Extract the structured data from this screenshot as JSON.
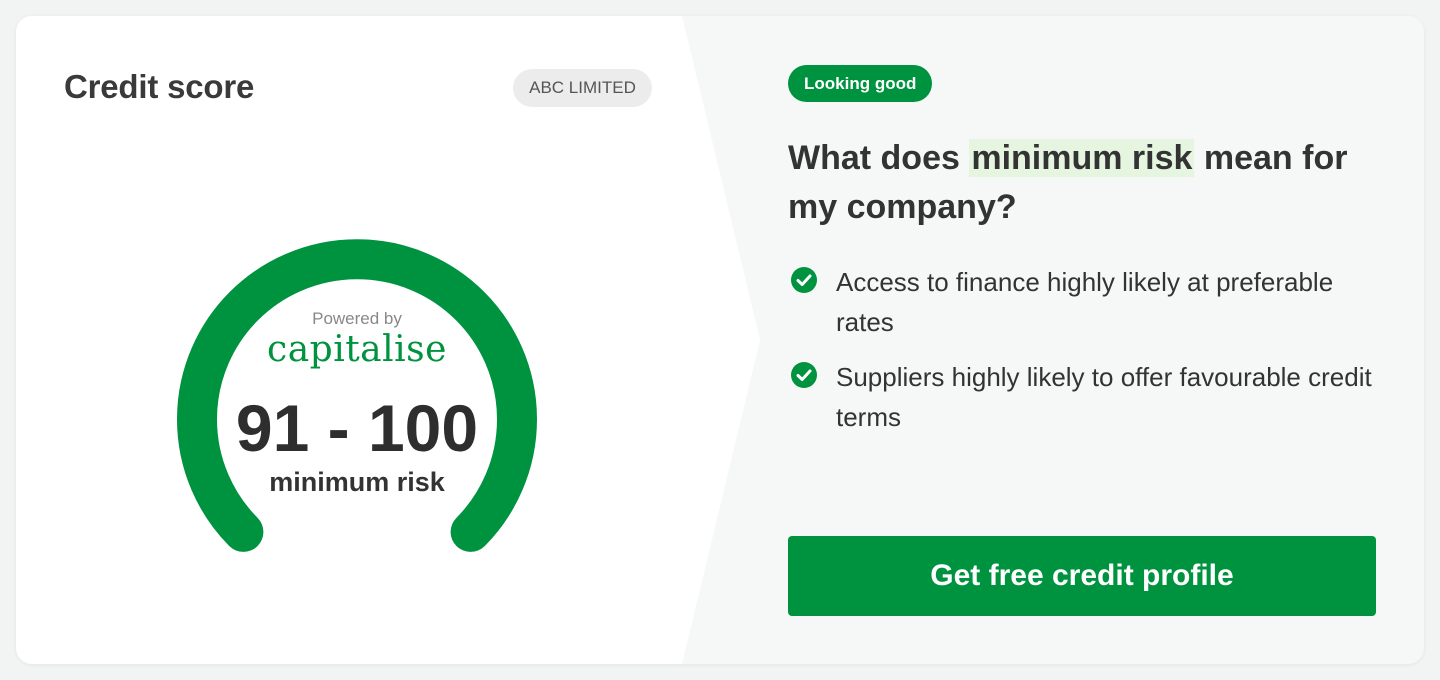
{
  "card": {
    "title": "Credit score",
    "company_name": "ABC LIMITED"
  },
  "gauge": {
    "powered_by": "Powered by",
    "brand": "capitalise",
    "score_range": "91 - 100",
    "risk_label": "minimum risk",
    "color": "#00933f"
  },
  "insight": {
    "status_badge": "Looking good",
    "question_prefix": "What does ",
    "question_highlight": "minimum risk",
    "question_suffix": " mean for my company?",
    "benefits": [
      {
        "icon": "check-circle-icon",
        "text": "Access to finance highly likely at preferable rates"
      },
      {
        "icon": "check-circle-icon",
        "text": "Suppliers highly likely to offer favourable credit terms"
      }
    ],
    "cta_label": "Get free credit profile"
  },
  "colors": {
    "accent": "#00933f",
    "highlight": "#e6f5e0",
    "badge_grey": "#ececec",
    "panel_bg": "#f6f8f7"
  }
}
